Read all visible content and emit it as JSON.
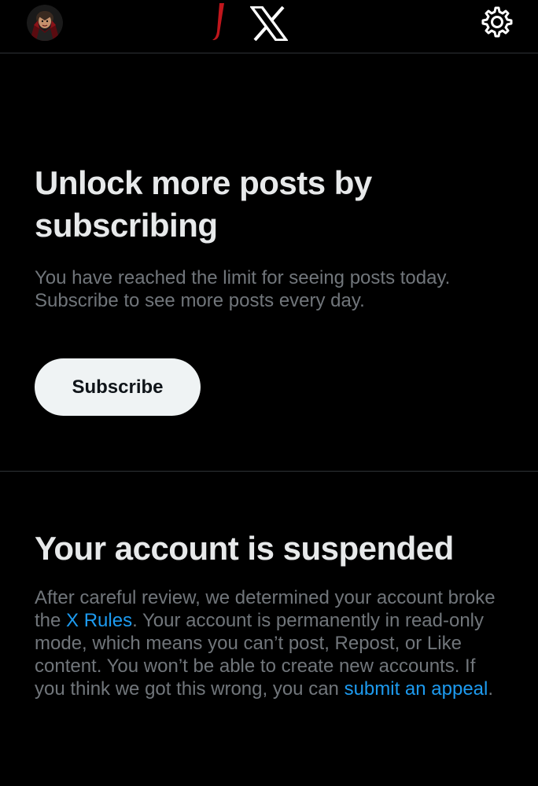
{
  "header": {
    "avatar_icon": "vampire-emoji-avatar",
    "logo_icon": "x-logo-icon",
    "settings_icon": "gear-icon",
    "accent_mark_color": "#c0161c"
  },
  "subscribe_prompt": {
    "title": "Unlock more posts by subscribing",
    "description": "You have reached the limit for seeing posts today. Subscribe to see more posts every day.",
    "button_label": "Subscribe"
  },
  "suspension": {
    "title": "Your account is suspended",
    "text_before_rules": "After careful review, we determined your account broke the ",
    "rules_link": "X Rules",
    "text_after_rules": ". Your account is permanently in read-only mode, which means you can’t post, Repost, or Like content. You won’t be able to create new accounts. If you think we got this wrong, you can ",
    "appeal_link": "submit an appeal",
    "text_end": "."
  },
  "colors": {
    "background": "#000000",
    "primary_text": "#e7e9ea",
    "secondary_text": "#71767b",
    "link": "#1d9bf0",
    "button_bg": "#eff3f4",
    "divider": "#2f3336"
  }
}
